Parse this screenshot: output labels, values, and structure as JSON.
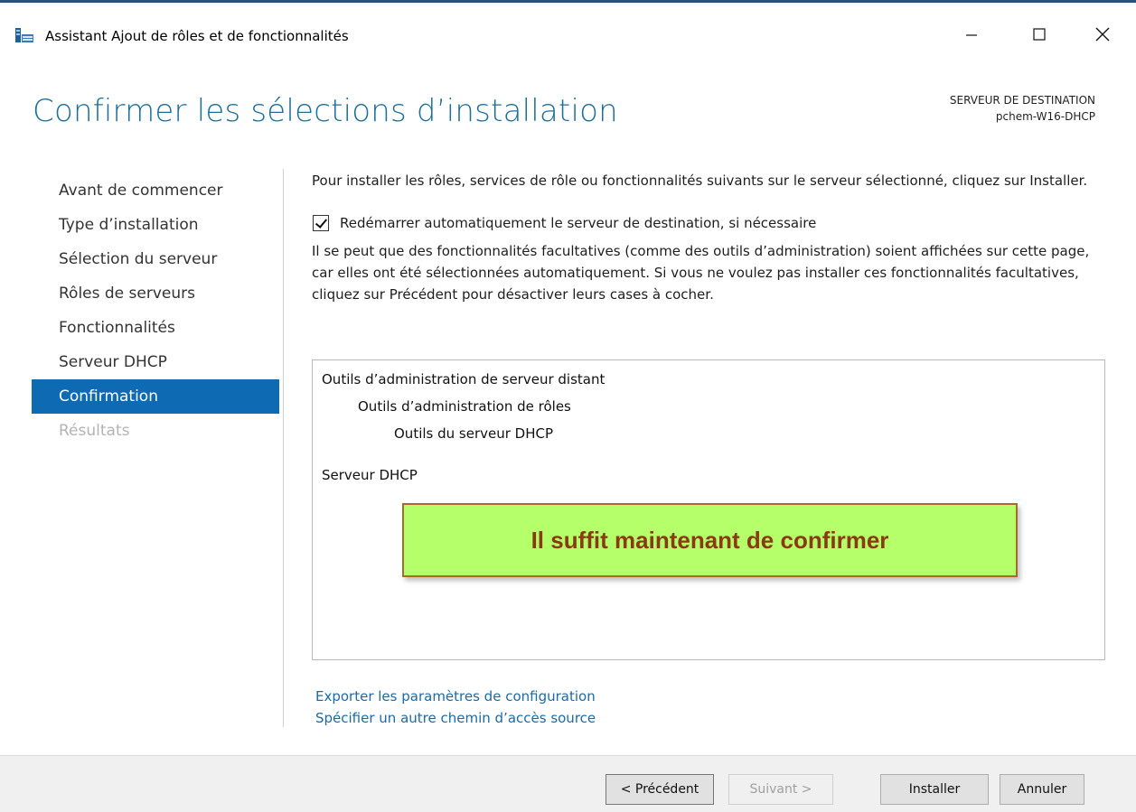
{
  "window": {
    "title": "Assistant Ajout de rôles et de fonctionnalités",
    "minimize_glyph": "—",
    "maximize_glyph": "☐",
    "close_glyph": "✕"
  },
  "header": {
    "title": "Confirmer les sélections d’installation",
    "destination_label": "SERVEUR DE DESTINATION",
    "destination_server": "pchem-W16-DHCP"
  },
  "nav": {
    "items": [
      {
        "label": "Avant de commencer"
      },
      {
        "label": "Type d’installation"
      },
      {
        "label": "Sélection du serveur"
      },
      {
        "label": "Rôles de serveurs"
      },
      {
        "label": "Fonctionnalités"
      },
      {
        "label": "Serveur DHCP"
      },
      {
        "label": "Confirmation"
      },
      {
        "label": "Résultats"
      }
    ]
  },
  "main": {
    "intro": "Pour installer les rôles, services de rôle ou fonctionnalités suivants sur le serveur sélectionné, cliquez sur Installer.",
    "restart_checkbox_label": "Redémarrer automatiquement le serveur de destination, si nécessaire",
    "note": "Il se peut que des fonctionnalités facultatives (comme des outils d’administration) soient affichées sur cette page, car elles ont été sélectionnées automatiquement. Si vous ne voulez pas installer ces fonctionnalités facultatives, cliquez sur Précédent pour désactiver leurs cases à cocher.",
    "selections": [
      "Outils d’administration de serveur distant",
      "Outils d’administration de rôles",
      "Outils du serveur DHCP",
      "Serveur DHCP"
    ],
    "callout": "Il suffit maintenant de confirmer",
    "export_link": "Exporter les paramètres de configuration",
    "source_link": "Spécifier un autre chemin d’accès source"
  },
  "footer": {
    "prev_label": "< Précédent",
    "next_label": "Suivant >",
    "install_label": "Installer",
    "cancel_label": "Annuler"
  },
  "colors": {
    "title_blue": "#1d6f9a",
    "nav_active": "#0f6ab4",
    "link_blue": "#1c6aa6",
    "callout_bg": "#b5ff6a",
    "callout_text": "#8a3a10"
  }
}
